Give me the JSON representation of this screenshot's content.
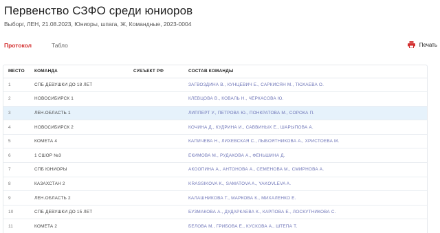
{
  "page": {
    "title": "Первенство СЗФО среди юниоров",
    "subtitle": "Выборг, ЛЕН, 21.08.2023, Юниоры, шпага, Ж, Командные, 2023-0004"
  },
  "tabs": [
    {
      "label": "Протокол",
      "active": true
    },
    {
      "label": "Табло",
      "active": false
    }
  ],
  "print": {
    "label": "Печать",
    "icon": "printer-icon"
  },
  "colors": {
    "accent": "#d32f2f",
    "highlight": "#e6f2fb",
    "members": "#6f76b8"
  },
  "table": {
    "columns": [
      "МЕСТО",
      "КОМАНДА",
      "СУБЪЕКТ РФ",
      "СОСТАВ КОМАНДЫ"
    ],
    "rows": [
      {
        "place": "1",
        "team": "СПБ ДЕВУШКИ ДО 18 ЛЕТ",
        "region": "",
        "members": "ЗАГВОЗДИНА В., КУНЦЕВИЧ Е., САРКИСЯН М., ТЮХАЕВА О."
      },
      {
        "place": "2",
        "team": "НОВОСИБИРСК 1",
        "region": "",
        "members": "КЛЕВЦОВА В., КОВАЛЬ Н., ЧЕРКАСОВА Ю."
      },
      {
        "place": "3",
        "team": "ЛЕН.ОБЛАСТЬ 1",
        "region": "",
        "members": "ЛИППЕРТ У., ПЕТРОВА Ю., ПОНКРАТОВА М., СОРОКА П."
      },
      {
        "place": "4",
        "team": "НОВОСИБИРСК 2",
        "region": "",
        "members": "КОЧИНА Д., КУДРИНА И., САВВИНЫХ Е., ШАРЫПОВА А."
      },
      {
        "place": "5",
        "team": "КОМЕТА 4",
        "region": "",
        "members": "КАПИЧЕВА Н., ЛИХЕВСКАЯ С., ЛЫБОЯТНИКОВА А., ХРИСТОЕВА М."
      },
      {
        "place": "6",
        "team": "1 СШОР №3",
        "region": "",
        "members": "ЕКИМОВА М., РУДАКОВА А., ФЕНЬШИНА Д."
      },
      {
        "place": "7",
        "team": "СПБ ЮНИОРЫ",
        "region": "",
        "members": "АКООПИНА А., АНТОНОВА А., СЕМЕНОВА М., СМИРНОВА А."
      },
      {
        "place": "8",
        "team": "КАЗАХСТАН 2",
        "region": "",
        "members": "KRASSIKOVA K., SAMATOVA A., YAKOVLEVA A."
      },
      {
        "place": "9",
        "team": "ЛЕН.ОБЛАСТЬ 2",
        "region": "",
        "members": "КАЛАШНИКОВА Т., МАРКОВА К., МИХАЛЕНКО Е."
      },
      {
        "place": "10",
        "team": "СПБ ДЕВУШКИ ДО 15 ЛЕТ",
        "region": "",
        "members": "БУЗМАКОВА А., ДУДАРКАЕВА К., КАРПОВА Е., ЛОСКУТНИКОВА С."
      },
      {
        "place": "11",
        "team": "КОМЕТА 2",
        "region": "",
        "members": "БЕЛОВА М., ГРИБОВА Е., КУСКОВА А., ШТЕПА Т."
      }
    ]
  }
}
